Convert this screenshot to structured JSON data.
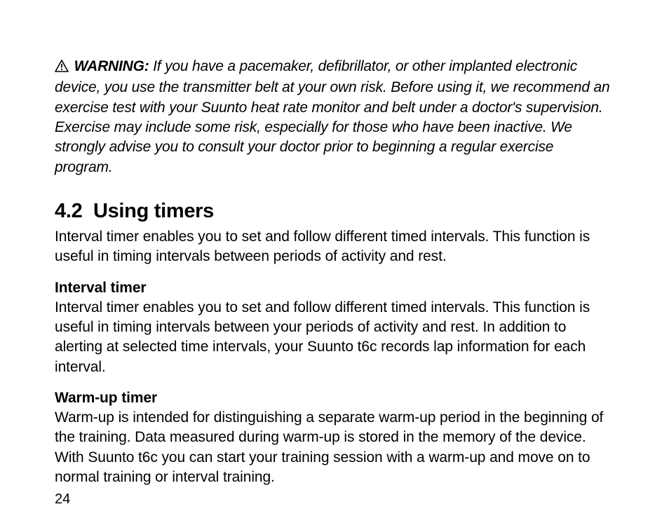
{
  "warning": {
    "icon_name": "warning-triangle-icon",
    "label": "WARNING:",
    "text": "If you have a pacemaker, defibrillator, or other implanted electronic device, you use the transmitter belt at your own risk. Before using it, we recommend an exercise test with your Suunto heat rate monitor and belt under a doctor's supervision. Exercise may include some risk, especially for those who have been inactive. We strongly advise you to consult your doctor prior to beginning a regular exercise program."
  },
  "section": {
    "number": "4.2",
    "title": "Using timers",
    "intro": "Interval timer enables you to set and follow different timed intervals. This function is useful in timing intervals between periods of activity and rest.",
    "subsections": [
      {
        "heading": "Interval timer",
        "body": "Interval timer enables you to set and follow different timed intervals. This function is useful in timing intervals between your periods of activity and rest. In addition to alerting at selected time intervals, your Suunto t6c records lap information for each interval."
      },
      {
        "heading": "Warm-up timer",
        "body": "Warm-up is intended for distinguishing a separate warm-up period in the beginning of the training. Data measured during warm-up is stored in the memory of the device. With Suunto t6c you can start your training session with a warm-up and move on to normal training or interval training."
      }
    ]
  },
  "page_number": "24"
}
